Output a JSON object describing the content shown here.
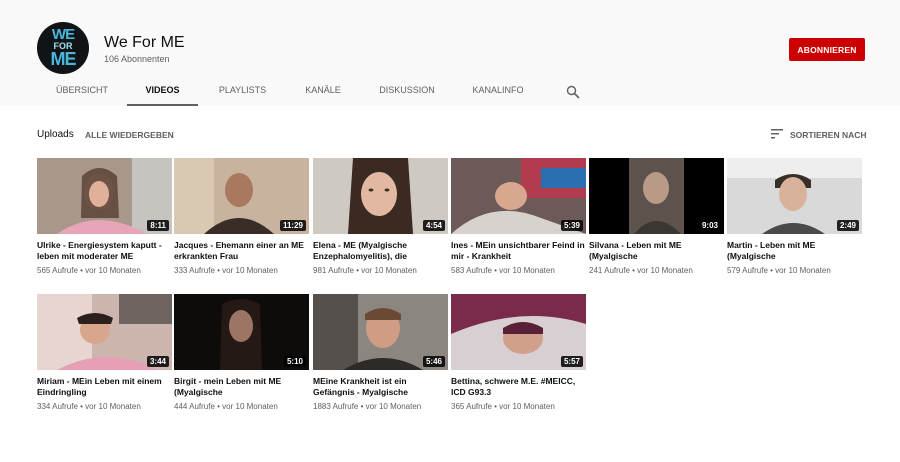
{
  "channel": {
    "logo_text": [
      "WE",
      "FOR",
      "ME"
    ],
    "name": "We For ME",
    "subscribers": "106 Abonnenten",
    "subscribe_label": "ABONNIEREN"
  },
  "tabs": [
    "ÜBERSICHT",
    "VIDEOS",
    "PLAYLISTS",
    "KANÄLE",
    "DISKUSSION",
    "KANALINFO"
  ],
  "active_tab": "VIDEOS",
  "section": {
    "title": "Uploads",
    "play_all": "ALLE WIEDERGEBEN",
    "sort_label": "SORTIEREN NACH"
  },
  "colors": {
    "subscribe_red": "#cc0000",
    "header_bg": "#f9f9f9",
    "logo_blue": "#48b7d9"
  },
  "icons": {
    "search": "search-icon",
    "sort": "sort-icon"
  },
  "videos": [
    {
      "title": "Ulrike - Energiesystem kaputt - leben mit moderater ME",
      "views": "565 Aufrufe",
      "age": "vor 10 Monaten",
      "duration": "8:11"
    },
    {
      "title": "Jacques - Ehemann einer an ME erkrankten Frau",
      "views": "333 Aufrufe",
      "age": "vor 10 Monaten",
      "duration": "11:29"
    },
    {
      "title": "Elena - ME (Myalgische Enzephalomyelitis), die",
      "views": "981 Aufrufe",
      "age": "vor 10 Monaten",
      "duration": "4:54"
    },
    {
      "title": "Ines - MEin unsichtbarer Feind in mir - Krankheit",
      "views": "583 Aufrufe",
      "age": "vor 10 Monaten",
      "duration": "5:39"
    },
    {
      "title": "Silvana - Leben mit ME (Myalgische",
      "views": "241 Aufrufe",
      "age": "vor 10 Monaten",
      "duration": "9:03"
    },
    {
      "title": "Martin - Leben mit ME (Myalgische",
      "views": "579 Aufrufe",
      "age": "vor 10 Monaten",
      "duration": "2:49"
    },
    {
      "title": "Miriam - MEin Leben mit einem Eindringling",
      "views": "334 Aufrufe",
      "age": "vor 10 Monaten",
      "duration": "3:44"
    },
    {
      "title": "Birgit - mein Leben mit ME (Myalgische",
      "views": "444 Aufrufe",
      "age": "vor 10 Monaten",
      "duration": "5:10"
    },
    {
      "title": "MEine Krankheit ist ein Gefängnis - Myalgische",
      "views": "1883 Aufrufe",
      "age": "vor 10 Monaten",
      "duration": "5:46"
    },
    {
      "title": "Bettina, schwere M.E. #MEICC, ICD G93.3",
      "views": "365 Aufrufe",
      "age": "vor 10 Monaten",
      "duration": "5:57"
    }
  ]
}
